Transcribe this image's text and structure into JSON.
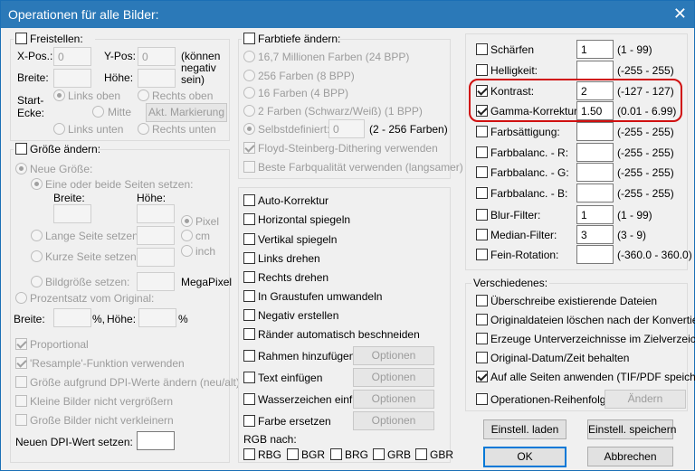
{
  "title": "Operationen für alle Bilder:",
  "close_icon": "✕",
  "crop": {
    "label": "Freistellen:",
    "xpos_label": "X-Pos.:",
    "xpos": "0",
    "ypos_label": "Y-Pos:",
    "ypos": "0",
    "note": [
      "(können",
      "negativ",
      "sein)"
    ],
    "width_label": "Breite:",
    "height_label": "Höhe:",
    "corner_label": [
      "Start-",
      "Ecke:"
    ],
    "top_left": "Links oben",
    "top_right": "Rechts oben",
    "center": "Mitte",
    "bottom_left": "Links unten",
    "bottom_right": "Rechts unten",
    "mark_button": "Akt. Markierung"
  },
  "resize": {
    "label": "Größe ändern:",
    "new_size": "Neue Größe:",
    "one_side": "Eine oder beide Seiten setzen:",
    "width_label": "Breite:",
    "height_label": "Höhe:",
    "unit_pixel": "Pixel",
    "unit_cm": "cm",
    "unit_inch": "inch",
    "long_side": "Lange Seite setzen:",
    "short_side": "Kurze Seite setzen:",
    "picture_size": "Bildgröße setzen:",
    "megapixel": "MegaPixel",
    "percent": "Prozentsatz vom Original:",
    "pct_width": "Breite:",
    "pct_unit1": "%,",
    "pct_height": "Höhe:",
    "pct_unit2": "%",
    "proportional": "Proportional",
    "resample": "'Resample'-Funktion verwenden",
    "dpi_resize": "Größe aufgrund DPI-Werte ändern (neu/alt)",
    "no_enlarge": "Kleine Bilder nicht vergrößern",
    "no_shrink": "Große Bilder nicht verkleinern",
    "new_dpi": "Neuen DPI-Wert setzen:"
  },
  "color_depth": {
    "label": "Farbtiefe ändern:",
    "opt1": "16,7 Millionen Farben (24 BPP)",
    "opt2": "256 Farben (8 BPP)",
    "opt3": "16 Farben (4 BPP)",
    "opt4": "2 Farben (Schwarz/Weiß) (1 BPP)",
    "custom": "Selbstdefiniert:",
    "custom_value": "0",
    "custom_range": "(2 - 256 Farben)",
    "dither": "Floyd-Steinberg-Dithering verwenden",
    "best": "Beste Farbqualität verwenden (langsamer)"
  },
  "ops": {
    "auto": "Auto-Korrektur",
    "hflip": "Horizontal spiegeln",
    "vflip": "Vertikal spiegeln",
    "rot_left": "Links drehen",
    "rot_right": "Rechts drehen",
    "gray": "In Graustufen umwandeln",
    "negative": "Negativ erstellen",
    "autocrop": "Ränder automatisch beschneiden",
    "frame": "Rahmen hinzufügen",
    "text": "Text einfügen",
    "watermark": "Wasserzeichen einf.",
    "replace": "Farbe ersetzen",
    "options": "Optionen",
    "rgb_label": "RGB nach:",
    "rbg": "RBG",
    "bgr": "BGR",
    "brg": "BRG",
    "grb": "GRB",
    "gbr": "GBR"
  },
  "adjust": [
    {
      "label": "Schärfen",
      "value": "1",
      "range": "(1 - 99)",
      "checked": false
    },
    {
      "label": "Helligkeit:",
      "value": "",
      "range": "(-255 - 255)",
      "checked": false
    },
    {
      "label": "Kontrast:",
      "value": "2",
      "range": "(-127 - 127)",
      "checked": true
    },
    {
      "label": "Gamma-Korrektur:",
      "value": "1.50",
      "range": "(0.01 - 6.99)",
      "checked": true
    },
    {
      "label": "Farbsättigung:",
      "value": "",
      "range": "(-255 - 255)",
      "checked": false
    },
    {
      "label": "Farbbalanc. - R:",
      "value": "",
      "range": "(-255 - 255)",
      "checked": false
    },
    {
      "label": "Farbbalanc. - G:",
      "value": "",
      "range": "(-255 - 255)",
      "checked": false
    },
    {
      "label": "Farbbalanc. - B:",
      "value": "",
      "range": "(-255 - 255)",
      "checked": false
    },
    {
      "label": "Blur-Filter:",
      "value": "1",
      "range": "(1 - 99)",
      "checked": false
    },
    {
      "label": "Median-Filter:",
      "value": "3",
      "range": "(3 - 9)",
      "checked": false
    },
    {
      "label": "Fein-Rotation:",
      "value": "",
      "range": "(-360.0 - 360.0)",
      "checked": false
    }
  ],
  "misc": {
    "label": "Verschiedenes:",
    "overwrite": "Überschreibe existierende Dateien",
    "delete_orig": "Originaldateien löschen nach der Konvertier.",
    "subdirs": "Erzeuge Unterverzeichnisse im Zielverzeichn.",
    "keep_date": "Original-Datum/Zeit behalten",
    "all_pages": "Auf alle Seiten anwenden (TIF/PDF speichern)",
    "order": "Operationen-Reihenfolge",
    "change": "Ändern"
  },
  "buttons": {
    "load": "Einstell. laden",
    "save": "Einstell. speichern",
    "ok": "OK",
    "cancel": "Abbrechen"
  }
}
